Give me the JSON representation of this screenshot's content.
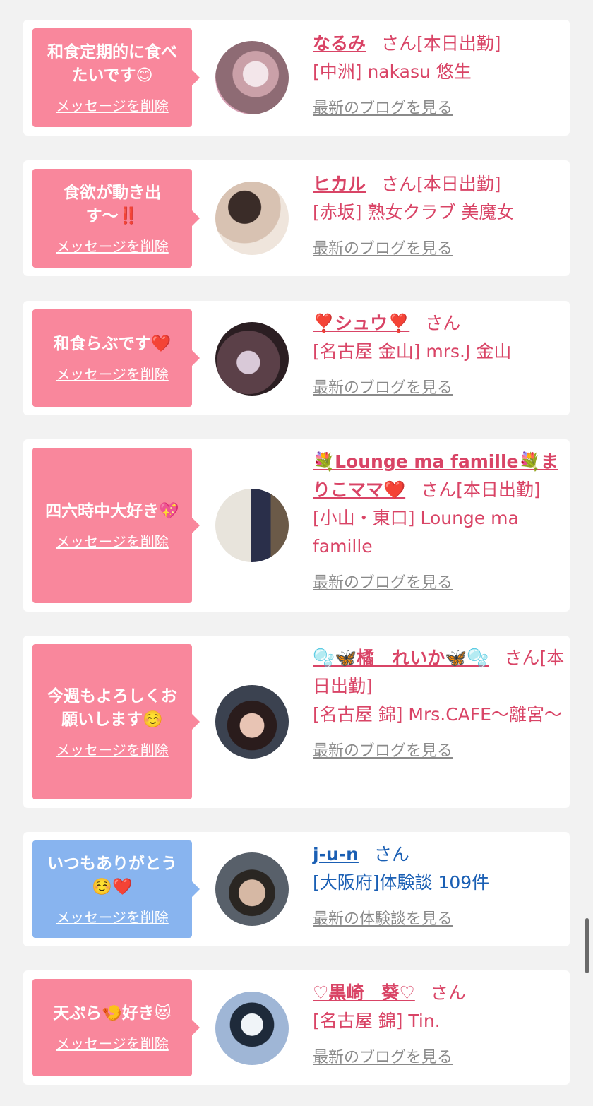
{
  "items": [
    {
      "message": "和食定期的に食べたいです😊",
      "delete_label": "メッセージを削除",
      "name": "なるみ",
      "san": "さん",
      "status": "[本日出勤]",
      "shop": "[中洲] nakasu 悠生",
      "link": "最新のブログを見る",
      "bubble_color": "pink"
    },
    {
      "message": "食欲が動き出す〜‼️",
      "delete_label": "メッセージを削除",
      "name": "ヒカル",
      "san": "さん",
      "status": "[本日出勤]",
      "shop": "[赤坂] 熟女クラブ 美魔女",
      "link": "最新のブログを見る",
      "bubble_color": "pink"
    },
    {
      "message": "和食らぶです❤️",
      "delete_label": "メッセージを削除",
      "name": "❣️シュウ❣️",
      "san": "さん",
      "status": "",
      "shop": "[名古屋 金山] mrs.J 金山",
      "link": "最新のブログを見る",
      "bubble_color": "pink"
    },
    {
      "message": "四六時中大好き💖",
      "delete_label": "メッセージを削除",
      "name": "💐Lounge ma famille💐まりこママ❤️",
      "san": "さん",
      "status": "[本日出勤]",
      "shop": "[小山・東口] Lounge ma famille",
      "link": "最新のブログを見る",
      "bubble_color": "pink"
    },
    {
      "message": "今週もよろしくお願いします☺️",
      "delete_label": "メッセージを削除",
      "name": "🫧🦋橘　れいか🦋🫧",
      "san": "さん",
      "status": "[本日出勤]",
      "shop": "[名古屋 錦] Mrs.CAFE〜離宮〜",
      "link": "最新のブログを見る",
      "bubble_color": "pink"
    },
    {
      "message": "いつもありがとう☺️❤️",
      "delete_label": "メッセージを削除",
      "name": "j-u-n",
      "san": "さん",
      "status": "",
      "shop": "[大阪府]体験談 109件",
      "link": "最新の体験談を見る",
      "bubble_color": "blue"
    },
    {
      "message": "天ぷら🍤好き😻",
      "delete_label": "メッセージを削除",
      "name": "♡黒崎　葵♡",
      "san": "さん",
      "status": "",
      "shop": "[名古屋 錦] Tin.",
      "link": "最新のブログを見る",
      "bubble_color": "pink"
    }
  ],
  "colors": {
    "pink_bubble": "#f9879c",
    "blue_bubble": "#88b4ef",
    "pink_text": "#d94466",
    "blue_text": "#1a5fb4"
  }
}
